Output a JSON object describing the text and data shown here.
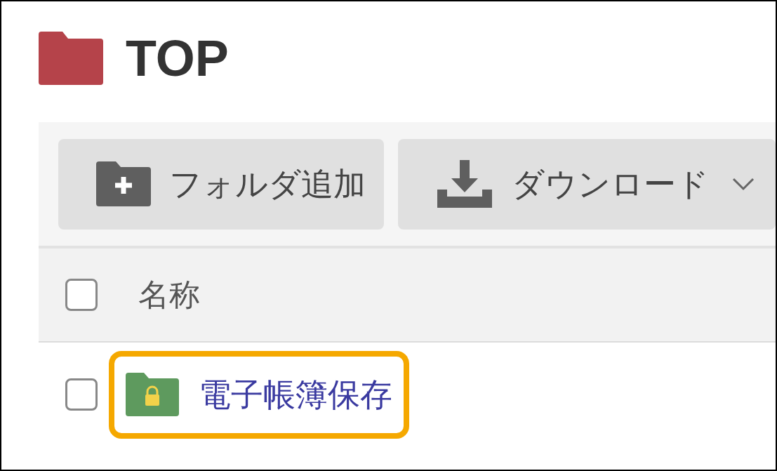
{
  "title": "TOP",
  "toolbar": {
    "buttons": [
      {
        "label": "フォルダ追加",
        "kind": "add-folder"
      },
      {
        "label": "ダウンロード",
        "kind": "download"
      }
    ]
  },
  "table": {
    "header": {
      "checked": false,
      "label": "名称"
    },
    "rows": [
      {
        "checked": false,
        "name": "電子帳簿保存",
        "locked": true,
        "highlighted": true
      }
    ]
  }
}
